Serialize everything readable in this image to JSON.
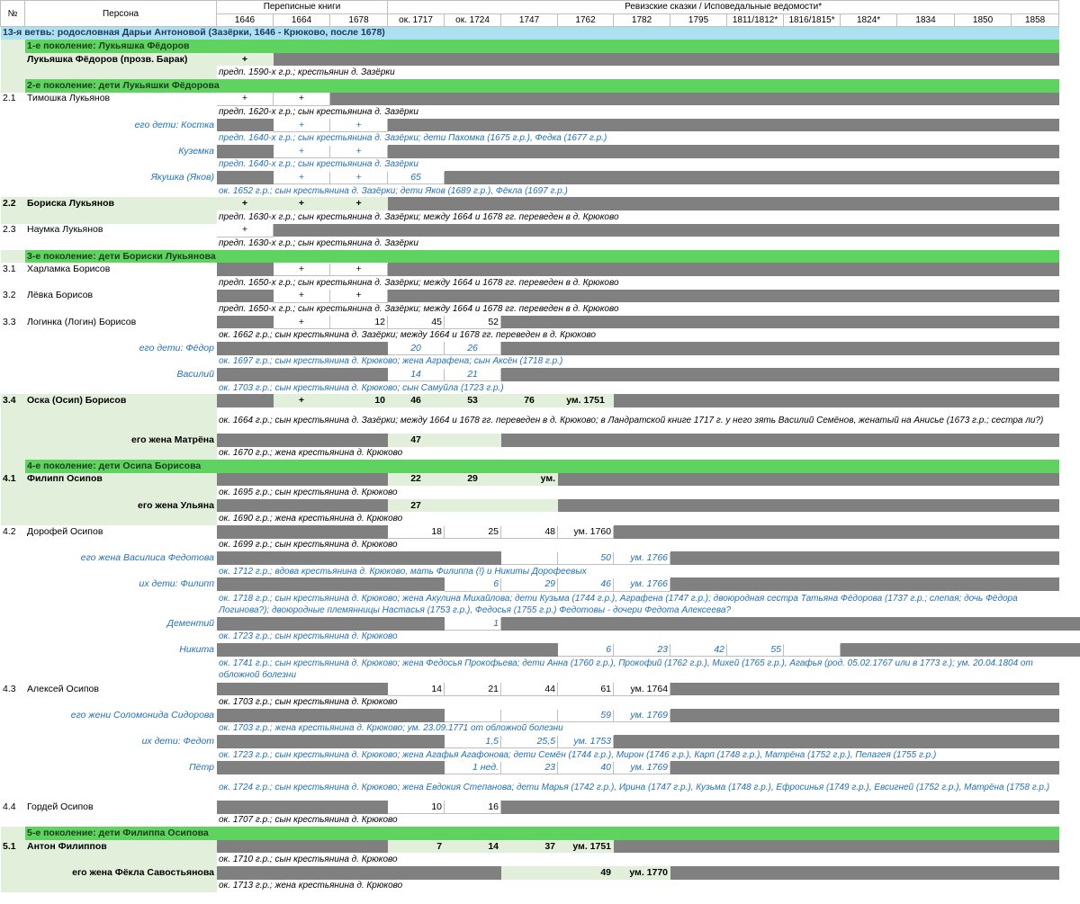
{
  "header": {
    "no": "№",
    "persona": "Персона",
    "census": "Переписные книги",
    "revision": "Ревизские сказки / Исповедальные ведомости*",
    "years": [
      "1646",
      "1664",
      "1678",
      "ок. 1717",
      "ок. 1724",
      "1747",
      "1762",
      "1782",
      "1795",
      "1811/1812*",
      "1816/1815*",
      "1824*",
      "1834",
      "1850",
      "1858"
    ]
  },
  "branch_title": "13-я ветвь: родословная Дарьи Антоновой (Зазёрки, 1646 - Крюково, после 1678)",
  "generations": {
    "g1": "1-е поколение: Лукьяшка Фёдоров",
    "g2": "2-е поколение: дети Лукьяшки Фёдорова",
    "g3": "3-е поколение: дети Бориски Лукьянова",
    "g4": "4-е поколение: дети Осипа Борисова",
    "g5": "5-е поколение: дети Филиппа Осипова"
  },
  "rows": {
    "r1": {
      "name": "Лукьяшка Фёдоров (прозв. Барак)",
      "v": [
        "+"
      ],
      "note": "предп. 1590-х г.р.; крестьянин д. Зазёрки"
    },
    "r21": {
      "no": "2.1",
      "name": "Тимошка Лукьянов",
      "v": [
        "+",
        "+"
      ],
      "note": "предп. 1620-х г.р.; сын крестьянина д. Зазёрки"
    },
    "r21a": {
      "name": "его дети: Костка",
      "v": [
        "+",
        "+"
      ],
      "note": "предп. 1640-х г.р.; сын крестьянина д. Зазёрки; дети Пахомка (1675 г.р.), Федка (1677 г.р.)"
    },
    "r21b": {
      "name": "Куземка",
      "v": [
        "+",
        "+"
      ],
      "note": "предп. 1640-х г.р.; сын крестьянина д. Зазёрки"
    },
    "r21c": {
      "name": "Якушка (Яков)",
      "v": [
        "+",
        "+",
        "65"
      ],
      "note": "ок. 1652 г.р.; сын крестьянина д. Зазёрки; дети Яков (1689 г.р.), Фёкла (1697 г.р.)"
    },
    "r22": {
      "no": "2.2",
      "name": "Бориска Лукьянов",
      "v": [
        "+",
        "+",
        "+"
      ],
      "note": "предп. 1630-х г.р.; сын крестьянина д. Зазёрки; между 1664 и 1678 гг. переведен в д. Крюково"
    },
    "r23": {
      "no": "2.3",
      "name": "Наумка Лукьянов",
      "v": [
        "+"
      ],
      "note": "предп. 1630-х г.р.; сын крестьянина д. Зазёрки"
    },
    "r31": {
      "no": "3.1",
      "name": "Харламка Борисов",
      "v": [
        "+",
        "+"
      ],
      "note": "предп. 1650-х г.р.; сын крестьянина д. Зазёрки; между 1664 и 1678 гг. переведен в д. Крюково"
    },
    "r32": {
      "no": "3.2",
      "name": "Лёвка Борисов",
      "v": [
        "+",
        "+"
      ],
      "note": "предп. 1650-х г.р.; сын крестьянина д. Зазёрки; между 1664 и 1678 гг. переведен в д. Крюково"
    },
    "r33": {
      "no": "3.3",
      "name": "Логинка (Логин) Борисов",
      "v": [
        "+",
        "12",
        "45",
        "52"
      ],
      "note": "ок. 1662 г.р.; сын крестьянина д. Зазёрки; между 1664 и 1678 гг. переведен в д. Крюково"
    },
    "r33a": {
      "name": "его дети: Фёдор",
      "v": [
        "20",
        "26"
      ],
      "note": "ок. 1697 г.р.; сын крестьянина д. Крюково; жена Аграфена; сын Аксён (1718 г.р.)"
    },
    "r33b": {
      "name": "Василий",
      "v": [
        "14",
        "21"
      ],
      "note": "ок. 1703 г.р.; сын крестьянина д. Крюково; сын Самуйла (1723 г.р.)"
    },
    "r34": {
      "no": "3.4",
      "name": "Оска (Осип) Борисов",
      "v": [
        "+",
        "10",
        "46",
        "53",
        "76",
        "ум. 1751"
      ],
      "note": "ок. 1664 г.р.; сын крестьянина д. Зазёрки; между 1664 и 1678 гг. переведен в д. Крюково; в Ландратской книге 1717 г. у него зять Василий Семёнов, женатый на Анисье (1673 г.р.; сестра ли?)"
    },
    "r34w": {
      "name": "его жена Матрёна",
      "v": [
        "47"
      ],
      "note": "ок. 1670 г.р.; жена крестьянина д. Крюково"
    },
    "r41": {
      "no": "4.1",
      "name": "Филипп Осипов",
      "v": [
        "22",
        "29",
        "ум."
      ],
      "note": "ок. 1695 г.р.; сын крестьянина д. Крюково"
    },
    "r41w": {
      "name": "его жена Ульяна",
      "v": [
        "27"
      ],
      "note": "ок. 1690 г.р.; жена крестьянина д. Крюково"
    },
    "r42": {
      "no": "4.2",
      "name": "Дорофей Осипов",
      "v": [
        "18",
        "25",
        "48",
        "ум. 1760"
      ],
      "note": "ок. 1699 г.р.; сын крестьянина д. Крюково"
    },
    "r42w": {
      "name": "его жена Василиса Федотова",
      "v": [
        "50",
        "ум. 1766"
      ],
      "note": "ок. 1712 г.р.; вдова крестьянина д. Крюково, мать Филиппа (!) и Никиты Дорофеевых"
    },
    "r42a": {
      "name": "их дети: Филипп",
      "v": [
        "6",
        "29",
        "46",
        "ум. 1766"
      ],
      "note": "ок. 1718 г.р.; сын крестьянина д. Крюково; жена Акулина Михайлова; дети Кузьма (1744 г.р.), Аграфена (1747 г.р.); двоюродная сестра Татьяна Фёдорова (1737 г.р.; слепая; дочь Фёдора Логинова?); двоюродные племянницы Настасья (1753 г.р.), Федосья (1755 г.р.) Федотовы - дочери Федота Алексеева?"
    },
    "r42b": {
      "name": "Дементий",
      "v": [
        "1"
      ],
      "note": "ок. 1723 г.р.; сын крестьянина д. Крюково"
    },
    "r42c": {
      "name": "Никита",
      "v": [
        "6",
        "23",
        "42",
        "55"
      ],
      "note": "ок. 1741 г.р.; сын крестьянина д. Крюково; жена Федосья Прокофьева; дети Анна (1760 г.р.), Прокофий (1762 г.р.), Михей (1765 г.р.), Агафья (род. 05.02.1767 или в 1773 г.); ум. 20.04.1804 от обложной болезни"
    },
    "r43": {
      "no": "4.3",
      "name": "Алексей Осипов",
      "v": [
        "14",
        "21",
        "44",
        "61",
        "ум. 1764"
      ],
      "note": "ок. 1703 г.р.; сын крестьянина д. Крюково"
    },
    "r43w": {
      "name": "его жени Соломонида Сидорова",
      "v": [
        "59",
        "ум. 1769"
      ],
      "note": "ок. 1703 г.р.; жена крестьянина д. Крюково; ум. 23.09.1771 от обложной болезни"
    },
    "r43a": {
      "name": "их дети: Федот",
      "v": [
        "1,5",
        "25,5",
        "ум. 1753"
      ],
      "note": "ок. 1723 г.р.; сын крестьянина д. Крюково; жена Агафья Агафонова; дети Семён (1744 г.р.), Мирон (1746 г.р.), Карп (1748 г.р.), Матрёна (1752 г.р.), Пелагея (1755 г.р.)"
    },
    "r43b": {
      "name": "Пётр",
      "v": [
        "1 нед.",
        "23",
        "40",
        "ум. 1769"
      ],
      "note": "ок. 1724 г.р.; сын крестьянина д. Крюково; жена Евдокия Степанова; дети Марья (1742 г.р.), Ирина (1747 г.р.), Кузьма (1748 г.р.), Ефросинья (1749 г.р.), Евсигней (1752 г.р.), Матрёна (1758 г.р.)"
    },
    "r44": {
      "no": "4.4",
      "name": "Гордей Осипов",
      "v": [
        "10",
        "16"
      ],
      "note": "ок. 1707 г.р.; сын крестьянина д. Крюково"
    },
    "r51": {
      "no": "5.1",
      "name": "Антон Филиппов",
      "v": [
        "7",
        "14",
        "37",
        "ум. 1751"
      ],
      "note": "ок. 1710 г.р.; сын крестьянина д. Крюково"
    },
    "r51w": {
      "name": "его жена Фёкла Савостьянова",
      "v": [
        "49",
        "ум. 1770"
      ],
      "note": "ок. 1713 г.р.; жена крестьянина д. Крюково"
    }
  },
  "colors": {
    "gray": "#808080",
    "light_green": "#e2efda",
    "sky": "#aee1f0",
    "green": "#5fd35f",
    "blue_text": "#1f70b8"
  }
}
